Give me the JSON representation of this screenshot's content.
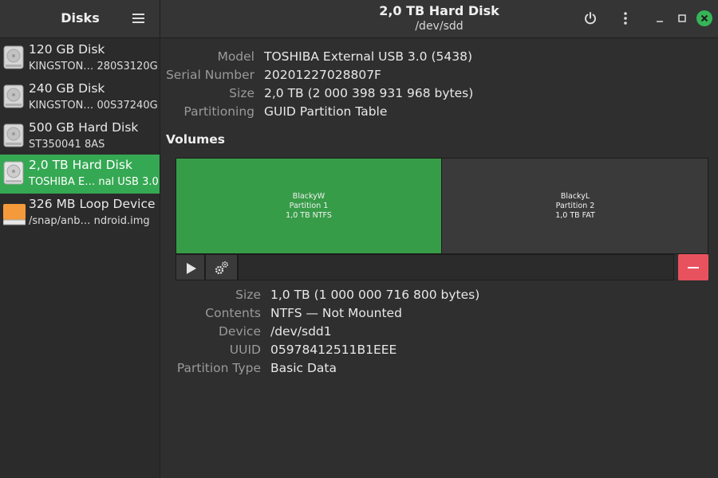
{
  "app": {
    "title": "Disks"
  },
  "header": {
    "title": "2,0 TB Hard Disk",
    "subtitle": "/dev/sdd"
  },
  "colors": {
    "accent": "#35a853",
    "partition_selected": "#379c48",
    "delete": "#e8525f",
    "close": "#35b558"
  },
  "sidebar": {
    "items": [
      {
        "name": "120 GB Disk",
        "model": "KINGSTON… 280S3120G",
        "icon": "hard-disk-icon",
        "selected": false
      },
      {
        "name": "240 GB Disk",
        "model": "KINGSTON… 00S37240G",
        "icon": "hard-disk-icon",
        "selected": false
      },
      {
        "name": "500 GB Hard Disk",
        "model": "ST350041 8AS",
        "icon": "hard-disk-icon",
        "selected": false
      },
      {
        "name": "2,0 TB Hard Disk",
        "model": "TOSHIBA E… nal USB 3.0",
        "icon": "hard-disk-icon",
        "selected": true
      },
      {
        "name": "326 MB Loop Device",
        "model": "/snap/anb… ndroid.img",
        "icon": "loop-device-icon",
        "selected": false
      }
    ]
  },
  "disk_info": {
    "model_label": "Model",
    "model": "TOSHIBA External USB 3.0 (5438)",
    "serial_label": "Serial Number",
    "serial": "20201227028807F",
    "size_label": "Size",
    "size": "2,0 TB (2 000 398 931 968 bytes)",
    "partitioning_label": "Partitioning",
    "partitioning": "GUID Partition Table"
  },
  "volumes": {
    "title": "Volumes",
    "partitions": [
      {
        "name": "BlackyW",
        "number": "Partition 1",
        "desc": "1,0 TB NTFS",
        "selected": true
      },
      {
        "name": "BlackyL",
        "number": "Partition 2",
        "desc": "1,0 TB FAT",
        "selected": false
      }
    ]
  },
  "partition_info": {
    "size_label": "Size",
    "size": "1,0 TB (1 000 000 716 800 bytes)",
    "contents_label": "Contents",
    "contents": "NTFS — Not Mounted",
    "device_label": "Device",
    "device": "/dev/sdd1",
    "uuid_label": "UUID",
    "uuid": "05978412511B1EEE",
    "type_label": "Partition Type",
    "type": "Basic Data"
  }
}
